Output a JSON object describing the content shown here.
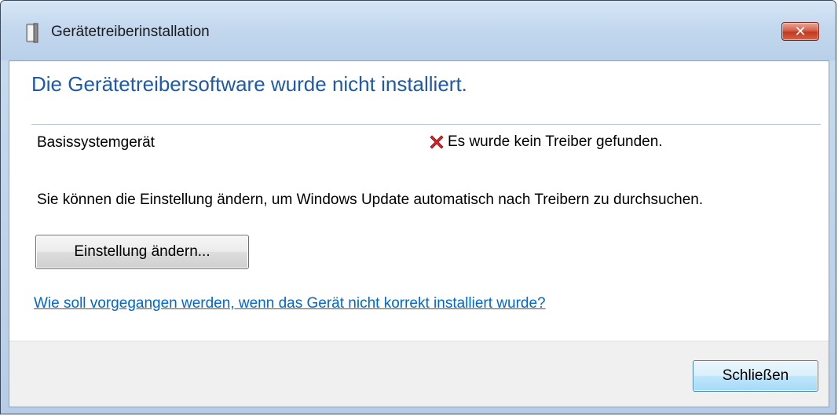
{
  "window": {
    "title": "Gerätetreiberinstallation",
    "close_glyph": "✕",
    "title_icon": "device-installer-icon"
  },
  "main": {
    "heading": "Die Gerätetreibersoftware wurde nicht installiert.",
    "device": {
      "name": "Basissystemgerät",
      "status_icon": "error-x-icon",
      "status_text": "Es wurde kein Treiber gefunden."
    },
    "info_text": "Sie können die Einstellung ändern, um Windows Update automatisch nach Treibern zu durchsuchen.",
    "change_button_label": "Einstellung ändern...",
    "help_link": "Wie soll vorgegangen werden, wenn das Gerät nicht korrekt installiert wurde?"
  },
  "footer": {
    "close_button_label": "Schließen"
  },
  "colors": {
    "heading": "#1e5aa8",
    "link": "#0066cc",
    "error": "#d3252a",
    "titlebar": "#c3d8ee",
    "footer": "#f0f0f0"
  }
}
